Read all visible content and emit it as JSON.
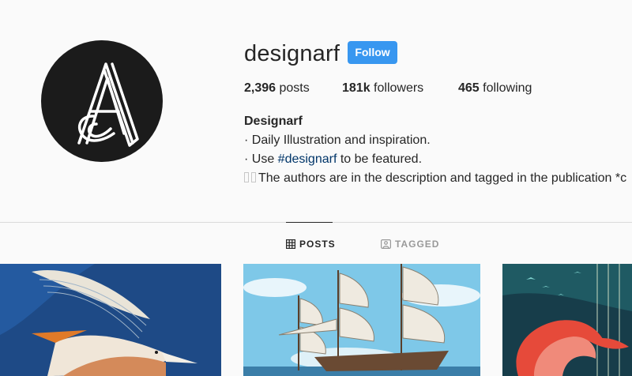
{
  "profile": {
    "username": "designarf",
    "follow_label": "Follow",
    "posts_count": "2,396",
    "posts_label": "posts",
    "followers_count": "181k",
    "followers_label": "followers",
    "following_count": "465",
    "following_label": "following",
    "display_name": "Designarf",
    "bio_line1": "· Daily Illustration and inspiration.",
    "bio_line2_prefix": "· Use ",
    "bio_hashtag": "#designarf",
    "bio_line2_suffix": " to be featured.",
    "bio_line3": "The authors are in the description and tagged in the publication *c"
  },
  "tabs": [
    {
      "label": "POSTS",
      "icon": "grid-icon",
      "active": true
    },
    {
      "label": "TAGGED",
      "icon": "tag-icon",
      "active": false
    }
  ],
  "colors": {
    "follow_button": "#3897f0",
    "hashtag": "#003569",
    "background": "#fafafa"
  }
}
